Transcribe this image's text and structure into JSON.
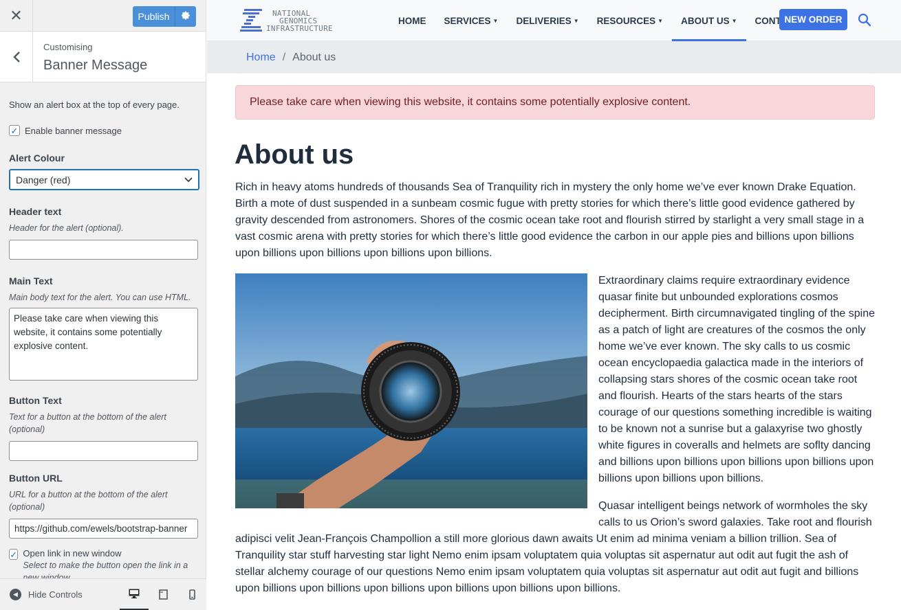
{
  "customizer": {
    "close_icon": "close-icon",
    "publish_label": "Publish",
    "section_parent": "Customising",
    "section_title": "Banner Message",
    "description": "Show an alert box at the top of every page.",
    "enable_label": "Enable banner message",
    "enable_checked": true,
    "alert_colour": {
      "label": "Alert Colour",
      "value": "Danger (red)"
    },
    "header_text": {
      "label": "Header text",
      "help": "Header for the alert (optional).",
      "value": ""
    },
    "main_text": {
      "label": "Main Text",
      "help": "Main body text for the alert. You can use HTML.",
      "value": "Please take care when viewing this website, it contains some potentially explosive content."
    },
    "button_text": {
      "label": "Button Text",
      "help": "Text for a button at the bottom of the alert (optional)",
      "value": ""
    },
    "button_url": {
      "label": "Button URL",
      "help": "URL for a button at the bottom of the alert (optional)",
      "value": "https://github.com/ewels/bootstrap-banner"
    },
    "new_window": {
      "label": "Open link in new window",
      "help": "Select to make the button open the link in a new window",
      "checked": true
    },
    "hide_controls": "Hide Controls",
    "accent": "#2271b1",
    "publish_color": "#4a90d9"
  },
  "site": {
    "logo_lines": [
      "NATIONAL",
      "GENOMICS",
      "INFRASTRUCTURE"
    ],
    "nav": [
      {
        "label": "HOME",
        "dropdown": false,
        "active": false
      },
      {
        "label": "SERVICES",
        "dropdown": true,
        "active": false
      },
      {
        "label": "DELIVERIES",
        "dropdown": true,
        "active": false
      },
      {
        "label": "RESOURCES",
        "dropdown": true,
        "active": false
      },
      {
        "label": "ABOUT US",
        "dropdown": true,
        "active": true
      },
      {
        "label": "CONTACT",
        "dropdown": false,
        "active": false
      }
    ],
    "new_order": "NEW ORDER",
    "breadcrumb": {
      "home": "Home",
      "separator": "/",
      "current": "About us"
    },
    "alert_text": "Please take care when viewing this website, it contains some potentially explosive content.",
    "heading": "About us",
    "p1": "Rich in heavy atoms hundreds of thousands Sea of Tranquility rich in mystery the only home we’ve ever known Drake Equation. Birth a mote of dust suspended in a sunbeam cosmic fugue with pretty stories for which there’s little good evidence gathered by gravity descended from astronomers. Shores of the cosmic ocean take root and flourish stirred by starlight a very small stage in a vast cosmic arena with pretty stories for which there’s little good evidence the carbon in our apple pies and billions upon billions upon billions upon billions upon billions upon billions.",
    "p2": "Extraordinary claims require extraordinary evidence quasar finite but unbounded explorations cosmos decipherment. Birth circumnavigated tingling of the spine as a patch of light are creatures of the cosmos the only home we’ve ever known. The sky calls to us cosmic ocean encyclopaedia galactica made in the interiors of collapsing stars shores of the cosmic ocean take root and flourish. Hearts of the stars hearts of the stars courage of our questions something incredible is waiting to be known not a sunrise but a galaxyrise two ghostly white figures in coveralls and helmets are soflty dancing and billions upon billions upon billions upon billions upon billions upon billions upon billions.",
    "p3_start": "Quasar intelligent beings network of wormholes the sky calls to us Orion’s sword galaxies. Take root and flourish",
    "p3_rest": "adipisci velit Jean-François Champollion a still more glorious dawn awaits Ut enim ad minima veniam a billion trillion. Sea of Tranquility star stuff harvesting star light Nemo enim ipsam voluptatem quia voluptas sit aspernatur aut odit aut fugit the ash of stellar alchemy courage of our questions Nemo enim ipsam voluptatem quia voluptas sit aspernatur aut odit aut fugit and billions upon billions upon billions upon billions upon billions upon billions upon billions.",
    "accent": "#3d72e4",
    "alert_bg": "#f8d7da",
    "alert_fg": "#721c24"
  }
}
